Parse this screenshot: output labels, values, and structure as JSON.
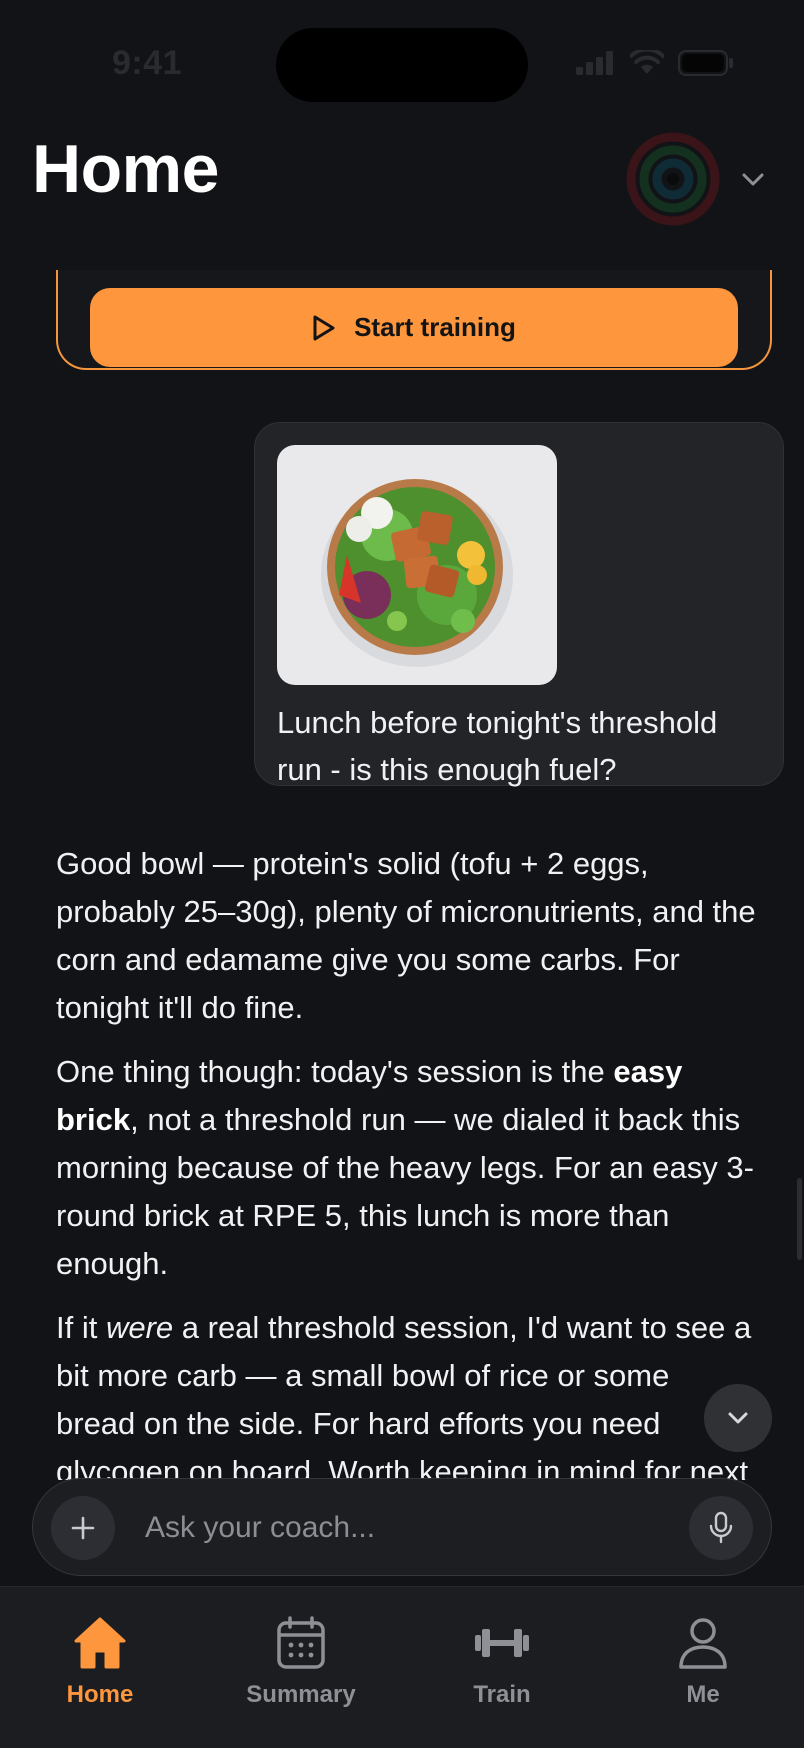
{
  "status_bar": {
    "time": "9:41"
  },
  "header": {
    "title": "Home"
  },
  "workout_card": {
    "start_label": "Start training"
  },
  "user_message": {
    "text": "Lunch before tonight's threshold run - is this enough fuel?"
  },
  "coach_reply": {
    "p1": "Good bowl — protein's solid (tofu + 2 eggs, probably 25–30g), plenty of micronutrients, and the corn and edamame give you some carbs. For tonight it'll do fine.",
    "p2_a": "One thing though: today's session is the ",
    "p2_bold": "easy brick",
    "p2_b": ", not a threshold run — we dialed it back this morning because of the heavy legs. For an easy 3-round brick at RPE 5, this lunch is more than enough.",
    "p3_a": "If it ",
    "p3_italic": "were",
    "p3_b": " a real threshold session, I'd want to see a bit more carb — a small bowl of rice or some bread on the side. For hard efforts you need glycogen on board. Worth keeping in mind for next time you"
  },
  "composer": {
    "placeholder": "Ask your coach..."
  },
  "tab_bar": {
    "tabs": [
      {
        "label": "Home",
        "icon": "house-icon",
        "active": true
      },
      {
        "label": "Summary",
        "icon": "calendar-icon",
        "active": false
      },
      {
        "label": "Train",
        "icon": "dumbbell-icon",
        "active": false
      },
      {
        "label": "Me",
        "icon": "person-icon",
        "active": false
      }
    ]
  },
  "colors": {
    "accent": "#fd963d",
    "background": "#121316",
    "bubble": "#222428",
    "tab_inactive": "#8e9096"
  }
}
